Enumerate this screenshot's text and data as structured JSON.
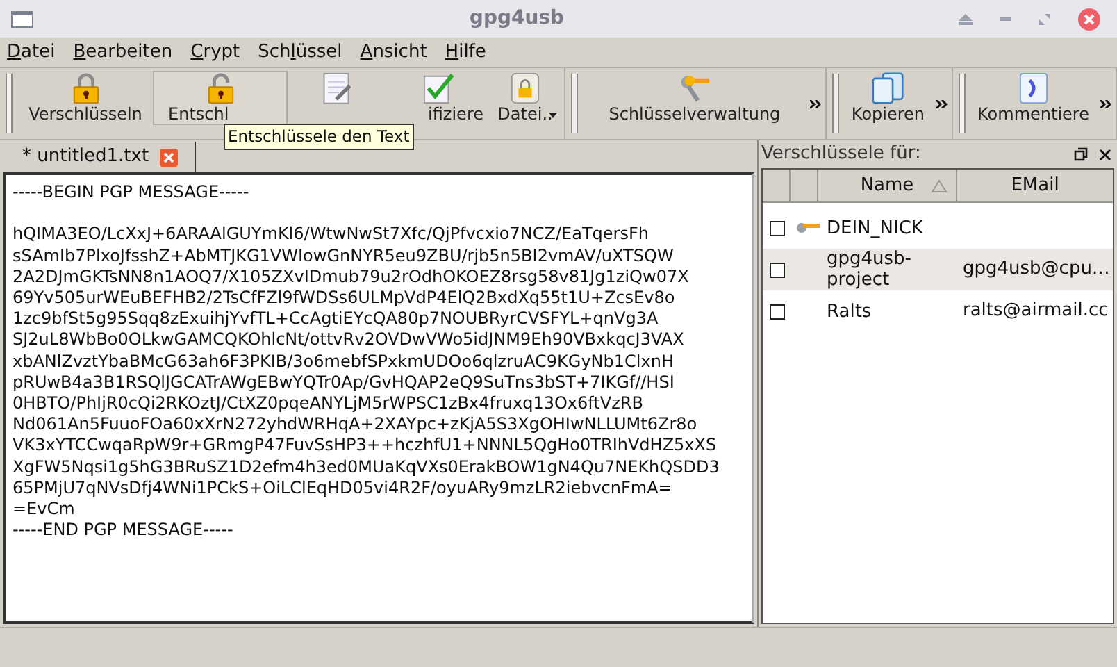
{
  "window": {
    "title": "gpg4usb"
  },
  "menu": [
    {
      "key": "D",
      "post": "atei"
    },
    {
      "key": "B",
      "post": "earbeiten"
    },
    {
      "key": "C",
      "post": "rypt"
    },
    {
      "pre": "Sch",
      "key": "l",
      "post": "üssel"
    },
    {
      "key": "A",
      "post": "nsicht"
    },
    {
      "key": "H",
      "post": "ilfe"
    }
  ],
  "toolbars": [
    {
      "items": [
        {
          "label": "Verschlüsseln",
          "kind": "lock",
          "hovered": false
        },
        {
          "label": "Entschl",
          "kind": "unlock",
          "hovered": true,
          "cut_end": true
        },
        {
          "kind": "sign",
          "hovered": false
        },
        {
          "label": "ifiziere",
          "kind": "verify",
          "hovered": false,
          "cut_start": true
        },
        {
          "label": "Datei..",
          "kind": "file",
          "hovered": false,
          "dropdown": true
        }
      ],
      "overflow": false
    },
    {
      "items": [
        {
          "label": "Schlüsselverwaltung",
          "kind": "keys",
          "hovered": false
        }
      ],
      "overflow": true
    },
    {
      "items": [
        {
          "label": "Kopieren",
          "kind": "copy",
          "hovered": false
        }
      ],
      "overflow": true
    },
    {
      "items": [
        {
          "label": "Kommentiere",
          "kind": "comment",
          "hovered": false
        }
      ],
      "overflow": true
    }
  ],
  "tooltip": "Entschlüssele den Text",
  "tabs": [
    {
      "label": "* untitled1.txt",
      "selected": true
    }
  ],
  "editor": {
    "begin": "-----BEGIN PGP MESSAGE-----",
    "body": [
      "hQIMA3EO/LcXxJ+6ARAAlGUYmKl6/WtwNwSt7Xfc/QjPfvcxio7NCZ/EaTqersFh",
      "sSAmIb7PlxoJfsshZ+AbMTJKG1VWIowGnNYR5eu9ZBU/rjb5n5BI2vmAV/uXTSQW",
      "2A2DJmGKTsNN8n1AOQ7/X105ZXvIDmub79u2rOdhOKOEZ8rsg58v81Jg1ziQw07X",
      "69Yv505urWEuBEFHB2/2TsCfFZl9fWDSs6ULMpVdP4ElQ2BxdXq55t1U+ZcsEv8o",
      "1zc9bfSt5g95Sqq8zExuihjYvfTL+CcAgtiEYcQA80p7NOUBRyrCVSFYL+qnVg3A",
      "SJ2uL8WbBo0OLkwGAMCQKOhlcNt/ottvRv2OVDwVWo5idJNM9Eh90VBxkqcJ3VAX",
      "xbANlZvztYbaBMcG63ah6F3PKIB/3o6mebfSPxkmUDOo6qlzruAC9KGyNb1ClxnH",
      "pRUwB4a3B1RSQlJGCATrAWgEBwYQTr0Ap/GvHQAP2eQ9SuTns3bST+7IKGf//HSI",
      "0HBTO/PhIjR0cQi2RKOztJ/CtXZ0pqeANYLjM5rWPSC1zBx4fruxq13Ox6ftVzRB",
      "Nd061An5FuuoFOa60xXrN272yhdWRHqA+2XAYpc+zKjA5S3XgOHIwNLLUMt6Zr8o",
      "VK3xYTCCwqaRpW9r+GRmgP47FuvSsHP3++hczhfU1+NNNL5QgHo0TRIhVdHZ5xXS",
      "XgFW5Nqsi1g5hG3BRuSZ1D2efm4h3ed0MUaKqVXs0ErakBOW1gN4Qu7NEKhQSDD3",
      "65PMjU7qNVsDfj4WNi1PCkS+OiLClEqHD05vi4R2F/oyuARy9mzLR2iebvcnFmA=",
      "=EvCm"
    ],
    "end": "-----END PGP MESSAGE-----"
  },
  "key_panel": {
    "title": "Verschlüssele für:",
    "columns": [
      "Name",
      "EMail"
    ],
    "rows": [
      {
        "name": "DEIN_NICK",
        "checked": false,
        "own_key": true,
        "selected": false
      },
      {
        "name": "gpg4usb-project",
        "email": "gpg4usb@cpu…",
        "checked": false,
        "own_key": false,
        "selected": true
      },
      {
        "name": "Ralts",
        "email": "ralts@airmail.cc",
        "checked": false,
        "own_key": false,
        "selected": false
      }
    ]
  }
}
